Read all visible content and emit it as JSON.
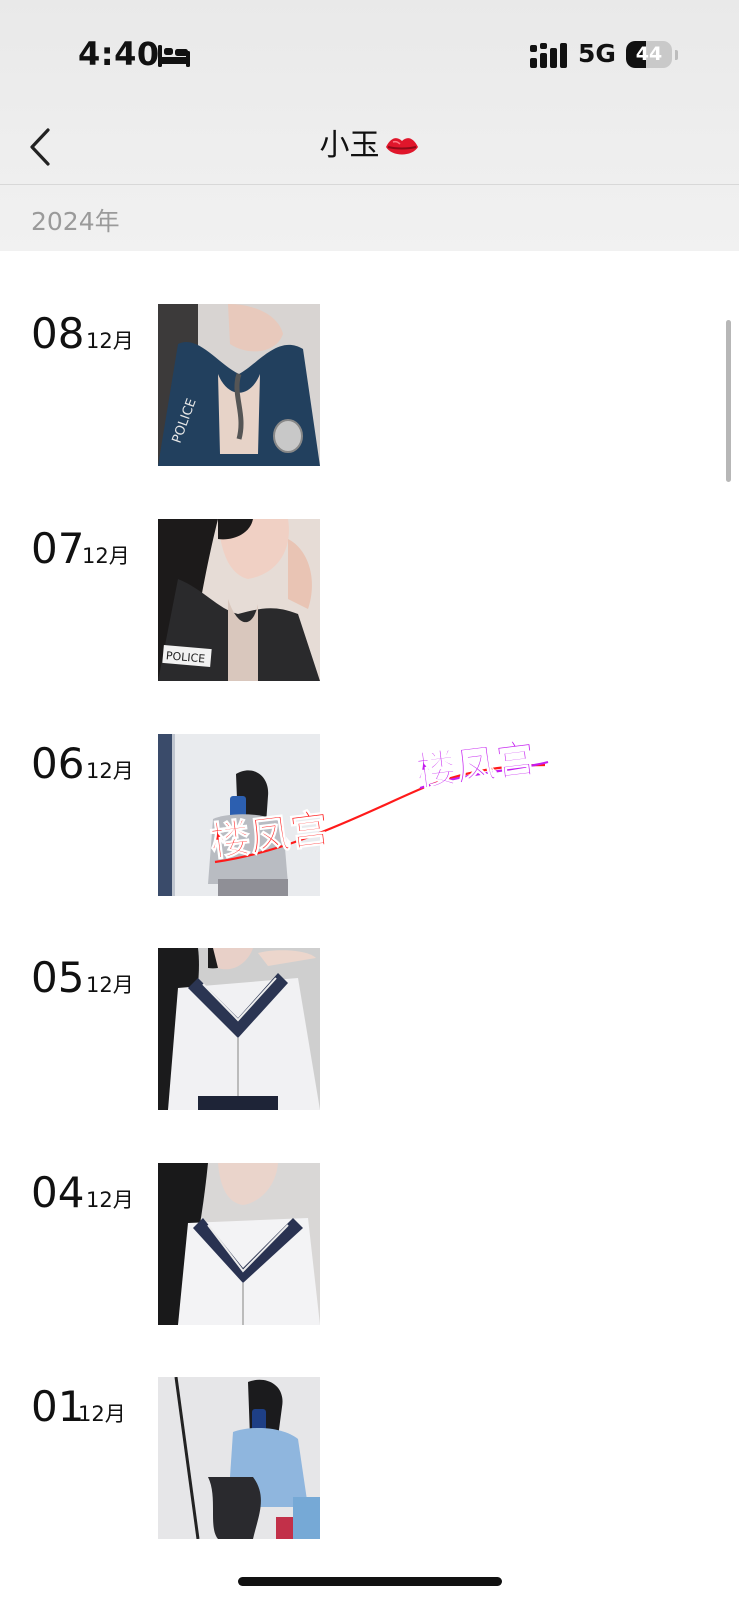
{
  "status_bar": {
    "time": "4:40",
    "network": "5G",
    "battery": "44",
    "battery_level": 0.44
  },
  "nav": {
    "title": "小玉",
    "title_emoji_icon": "kiss-lips-icon",
    "back_icon": "chevron-left-icon"
  },
  "year_label": "2024年",
  "entries": [
    {
      "day": "08",
      "month": "12月",
      "photo_desc": "police-uniform-photo"
    },
    {
      "day": "07",
      "month": "12月",
      "photo_desc": "police-uniform-photo"
    },
    {
      "day": "06",
      "month": "12月",
      "photo_desc": "mirror-selfie-photo"
    },
    {
      "day": "05",
      "month": "12月",
      "photo_desc": "sailor-uniform-photo"
    },
    {
      "day": "04",
      "month": "12月",
      "photo_desc": "sailor-uniform-photo"
    },
    {
      "day": "01",
      "month": "12月",
      "photo_desc": "mirror-selfie-photo"
    }
  ],
  "watermarks": [
    "楼凤宫",
    "楼凤宫"
  ],
  "colors": {
    "watermark_red": "#ff1a1a",
    "watermark_purple": "#c41cf0"
  }
}
